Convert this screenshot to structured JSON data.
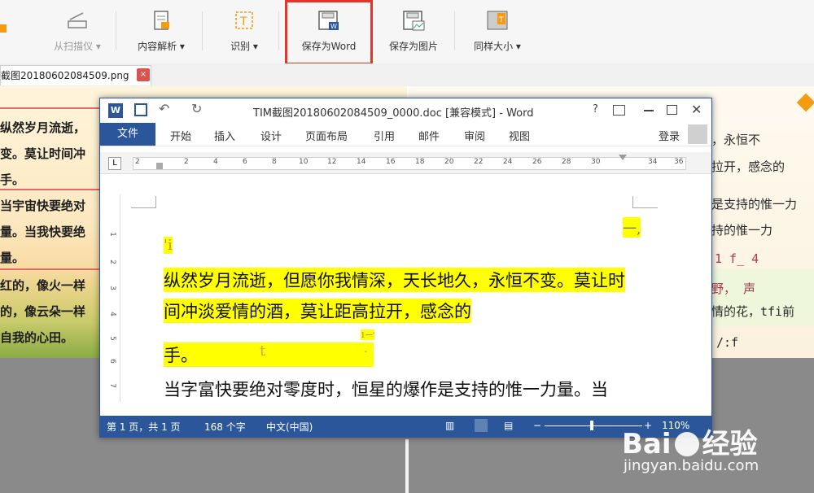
{
  "toolbar": {
    "items": [
      {
        "label": "从扫描仪",
        "disabled": true
      },
      {
        "label": "内容解析"
      },
      {
        "label": "识别"
      },
      {
        "label": "保存为Word"
      },
      {
        "label": "保存为图片"
      },
      {
        "label": "同样大小"
      }
    ],
    "dropdown_glyph": "▾"
  },
  "tab": {
    "filename": "截图20180602084509.png",
    "close": "×"
  },
  "left_image": {
    "lines": [
      "纵然岁月流逝，",
      "变。莫让时间冲",
      "手。",
      "当宇宙快要绝对",
      "量。当我快要绝",
      "量。",
      "红的，像火一样",
      "的，像云朵一样",
      "自我的心田。"
    ]
  },
  "right_image": {
    "lines": [
      "，永恒不",
      "拉开，感念的",
      "是支持的惟一力",
      "持的惟一力",
      "1  f_  4",
      "野，  声",
      "情的花，tfi前",
      "/:f"
    ]
  },
  "word": {
    "title": "TIM截图20180602084509_0000.doc [兼容模式] - Word",
    "help": "?",
    "file_tab": "文件",
    "tabs": [
      "开始",
      "插入",
      "设计",
      "页面布局",
      "引用",
      "邮件",
      "审阅",
      "视图"
    ],
    "login": "登录",
    "ruler_numbers": [
      "2",
      "2",
      "4",
      "6",
      "8",
      "10",
      "12",
      "14",
      "16",
      "18",
      "20",
      "22",
      "24",
      "26",
      "28",
      "30",
      "34",
      "36"
    ],
    "vruler_numbers": [
      "1",
      "2",
      "3",
      "4",
      "5",
      "6",
      "7"
    ],
    "doc": {
      "top_right": "一,",
      "line1": "'i",
      "line2": "纵然岁月流逝，但愿你我情深，天长地久，永恒不变。莫让时",
      "line3": "间冲淡爱情的酒，莫让距高拉开，感念的",
      "mid_note": "1一'",
      "line4": "手。",
      "line4_extra": "t",
      "line4_dot": ".",
      "line5": "当字富快要绝对零度时，恒星的爆作是支持的惟一力量。当"
    },
    "status": {
      "page": "第 1 页，共 1 页",
      "words": "168 个字",
      "lang": "中文(中国)",
      "zoom": "110%"
    }
  },
  "watermark": {
    "brand": "Bai",
    "brand2": "经验",
    "url": "jingyan.baidu.com"
  }
}
